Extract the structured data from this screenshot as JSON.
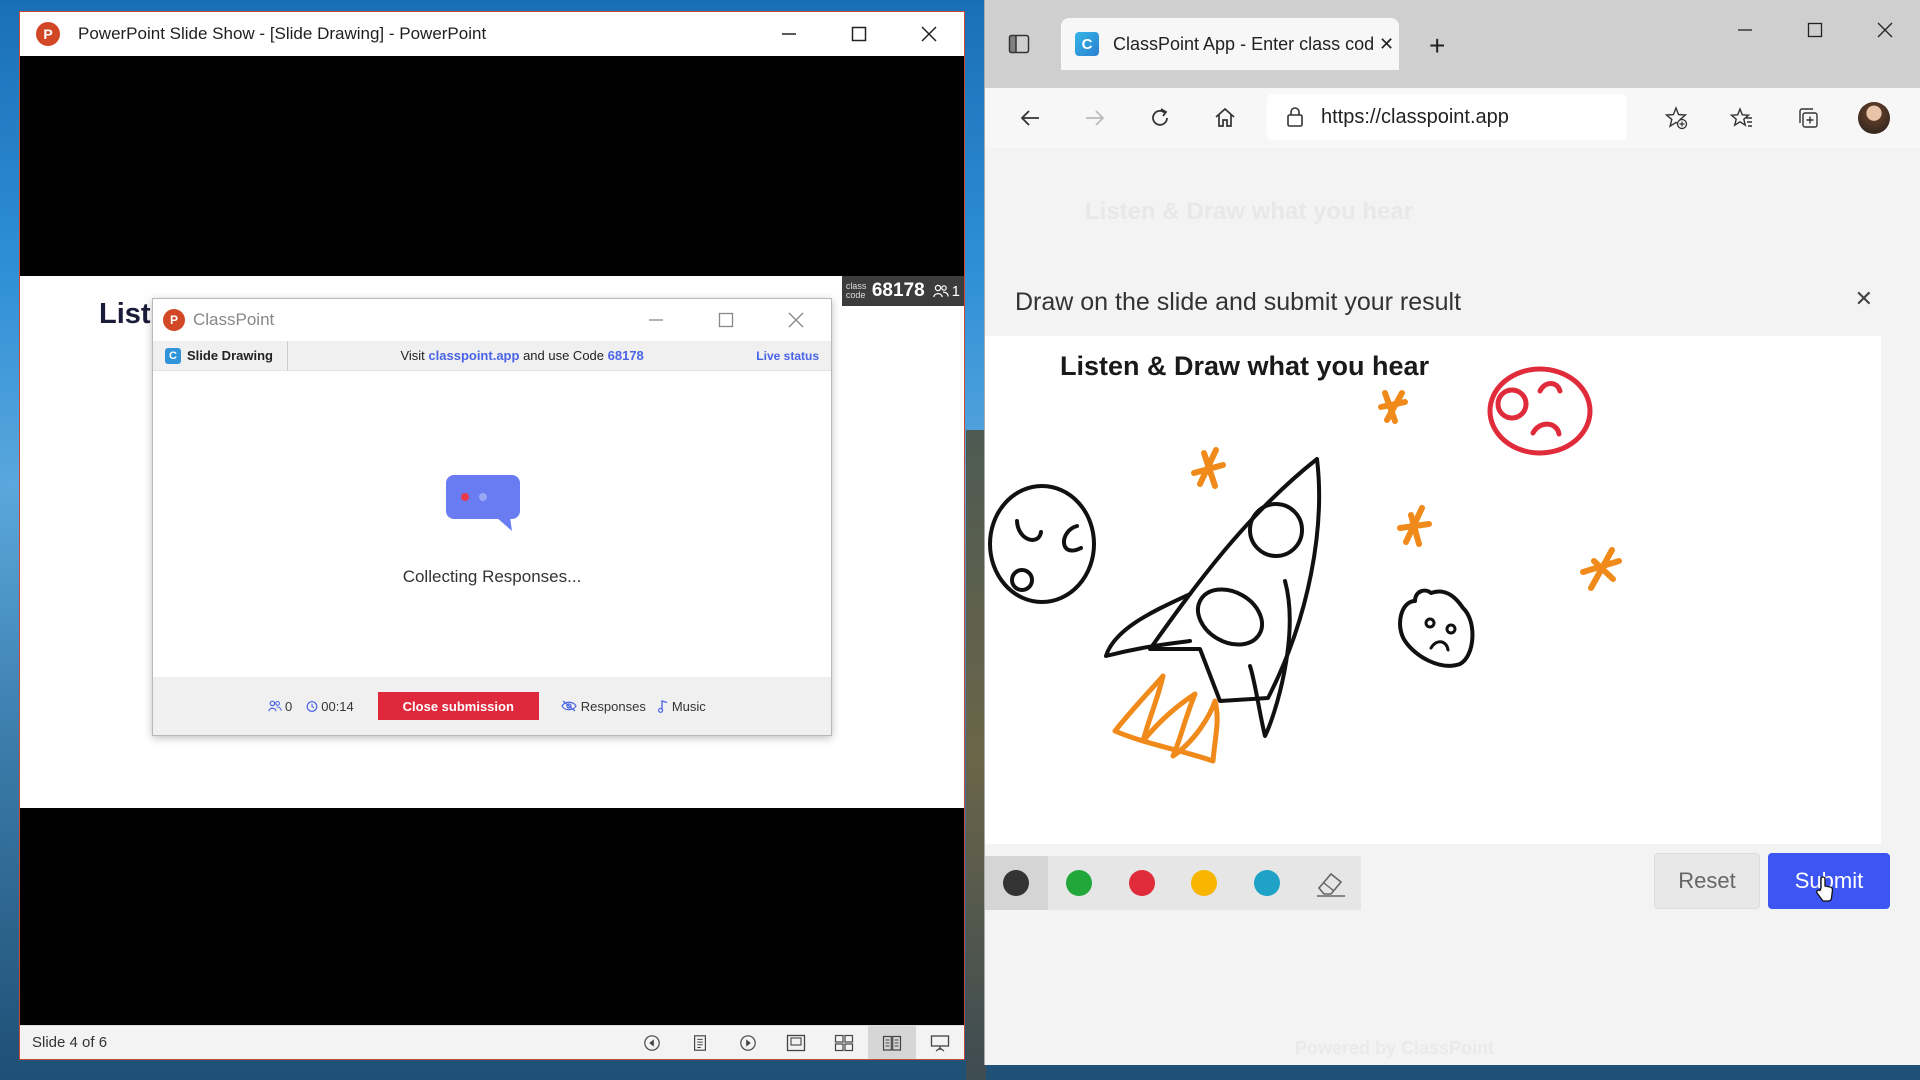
{
  "powerpoint": {
    "window_title": "PowerPoint Slide Show - [Slide Drawing] - PowerPoint",
    "logo_letter": "P",
    "slide_title": "List",
    "class_code_small": "class code",
    "class_code": "68178",
    "participants": "1",
    "status_text": "Slide 4 of 6"
  },
  "classpoint": {
    "title": "ClassPoint",
    "logo_letter": "P",
    "tab_label": "Slide Drawing",
    "tab_icon_letter": "C",
    "visit_prefix": "Visit",
    "visit_link": "classpoint.app",
    "visit_mid": "and use Code",
    "visit_code": "68178",
    "live_status": "Live status",
    "collecting": "Collecting Responses...",
    "responses_count": "0",
    "timer": "00:14",
    "close_submission": "Close submission",
    "responses_label": "Responses",
    "music_label": "Music",
    "accent_color": "#4a64e8",
    "close_color": "#e0283c"
  },
  "browser": {
    "tab_title": "ClassPoint App - Enter class code",
    "tab_favicon_letter": "C",
    "url": "https://classpoint.app",
    "faded_title": "Listen & Draw what you hear",
    "modal_heading": "Draw on the slide and submit your result",
    "canvas_title": "Listen & Draw what you hear",
    "reset_label": "Reset",
    "submit_label": "Submit",
    "faded_footer": "Powered by ClassPoint",
    "submit_color": "#3d55f2",
    "palette": [
      "#333333",
      "#22a83a",
      "#e02b3a",
      "#f7b500",
      "#1ea3c6"
    ]
  }
}
